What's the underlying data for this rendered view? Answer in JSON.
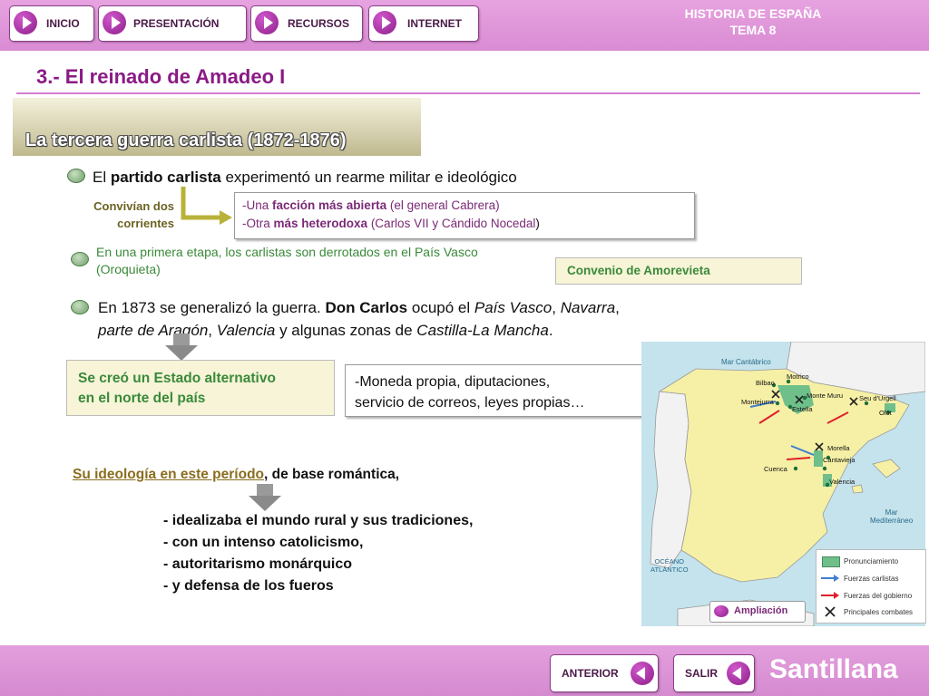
{
  "nav": {
    "inicio": "INICIO",
    "presentacion": "PRESENTACIÓN",
    "recursos": "RECURSOS",
    "internet": "INTERNET"
  },
  "course": {
    "line1": "HISTORIA DE ESPAÑA",
    "line2": "TEMA 8"
  },
  "section_title": "3.- El reinado de Amadeo I",
  "subtitle": "La tercera guerra carlista (1872-1876)",
  "point1": {
    "pre": "El ",
    "bold": "partido carlista",
    "post": " experimentó un rearme militar e ideológico"
  },
  "currents_label": {
    "line1": "Convivían dos",
    "line2": "corrientes"
  },
  "currents_box": {
    "l1_pre": "-Una ",
    "l1_bold": "facción más abierta",
    "l1_post": " (el general Cabrera)",
    "l2_pre": "-Otra ",
    "l2_bold": "más heterodoxa",
    "l2_post": " (Carlos VII y Cándido Nocedal",
    "l2_close": ")"
  },
  "point2": {
    "line1": "En una primera etapa, los carlistas son derrotados en el País Vasco",
    "line2": "(Oroquieta)"
  },
  "convenio": "Convenio de Amorevieta",
  "point3": {
    "a": "En 1873 se generalizó la guerra. ",
    "b": "Don Carlos",
    "c": " ocupó el ",
    "d": "País Vasco",
    "e": ", ",
    "f": "Navarra",
    "g": ",",
    "h": "parte de Aragón",
    "i": ", ",
    "j": "Valencia",
    "k": " y algunas zonas de ",
    "l": "Castilla-La Mancha",
    "m": "."
  },
  "estado_box": {
    "line1": "Se creó un Estado alternativo",
    "line2": "en el norte del país"
  },
  "moneda_box": {
    "line1": "-Moneda propia, diputaciones,",
    "line2": "servicio de correos, leyes propias…"
  },
  "ideology": {
    "link": "Su ideología en este período",
    "rest": ", de base romántica,"
  },
  "ideology_list": [
    "- idealizaba el mundo rural y sus tradiciones,",
    "- con un intenso catolicismo,",
    "- autoritarismo monárquico",
    "- y defensa de los fueros"
  ],
  "map": {
    "sea_north": "Mar Cantábrico",
    "sea_med_1": "Mar",
    "sea_med_2": "Mediterráneo",
    "ocean_1": "OCÉANO",
    "ocean_2": "ATLÁNTICO",
    "cities": {
      "bilbao": "Bilbao",
      "motrico": "Motrico",
      "montejurra": "Montejurra",
      "montemuru": "Monte Muru",
      "estella": "Estella",
      "seu": "Seu d'Urgell",
      "olot": "Olot",
      "morella": "Morella",
      "cantavieja": "Cantavieja",
      "cuenca": "Cuenca",
      "valencia": "Valencia"
    },
    "legend": {
      "pronunciamiento": "Pronunciamiento",
      "carlistas": "Fuerzas carlistas",
      "gobierno": "Fuerzas del gobierno",
      "combates": "Principales combates"
    },
    "colors": {
      "sea": "#c4e3ed",
      "land": "#f6f0a6",
      "portugal": "#f2f2f2",
      "carlist_zone": "#6fbf8a",
      "carlist_arrow": "#3f7ed1",
      "gov_arrow": "#e0202a"
    }
  },
  "ampliacion": "Ampliación",
  "footer": {
    "anterior": "ANTERIOR",
    "salir": "SALIR",
    "brand": "Santillana"
  }
}
